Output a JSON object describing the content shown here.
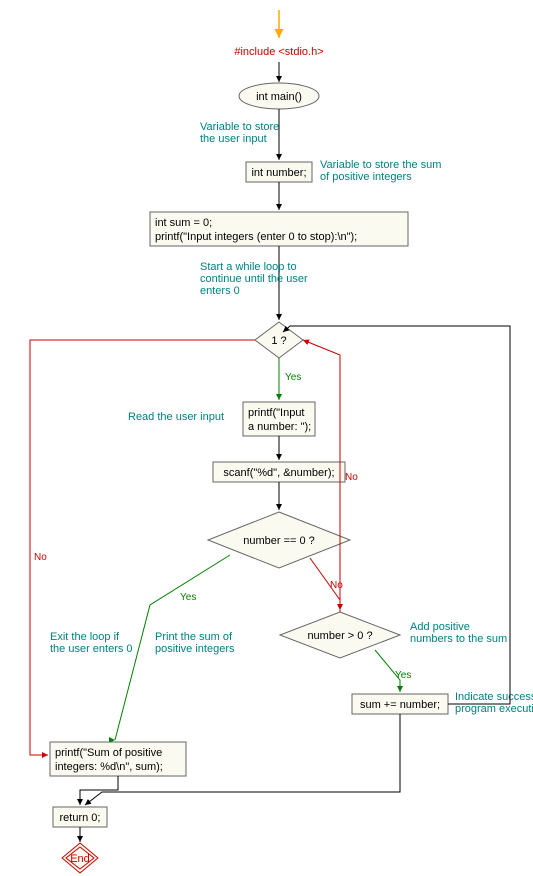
{
  "nodes": {
    "include": "#include <stdio.h>",
    "main": "int main()",
    "comment_var_input": "Variable to store\nthe user input",
    "decl_number": "int number;",
    "comment_var_sum": "Variable to store the sum\nof positive integers",
    "decl_sum_print": "int sum = 0;\nprintf(\"Input integers (enter 0 to stop):\\n\");",
    "comment_while": "Start a while loop to\ncontinue until the user\nenters 0",
    "cond_one": "1 ?",
    "printf_prompt": "printf(\"Input\na number: \");",
    "comment_read": "Read the user input",
    "scanf": "scanf(\"%d\", &number);",
    "cond_zero": "number == 0 ?",
    "comment_exit": "Exit the loop if\nthe user enters 0",
    "comment_print_sum": "Print the sum of\npositive integers",
    "cond_positive": "number > 0 ?",
    "comment_add": "Add positive\nnumbers to the sum",
    "sum_inc": "sum += number;",
    "comment_success": "Indicate successful\nprogram execution",
    "printf_result": "printf(\"Sum of positive\nintegers: %d\\n\", sum);",
    "return": "return 0;",
    "end": "End"
  },
  "labels": {
    "yes": "Yes",
    "no": "No"
  },
  "colors": {
    "code": "#cc0000",
    "comment": "#008080",
    "yes": "#008000",
    "no": "#cc0000",
    "stroke": "#666",
    "fill": "#fafaf0",
    "arrow_in": "#ffaa00"
  }
}
